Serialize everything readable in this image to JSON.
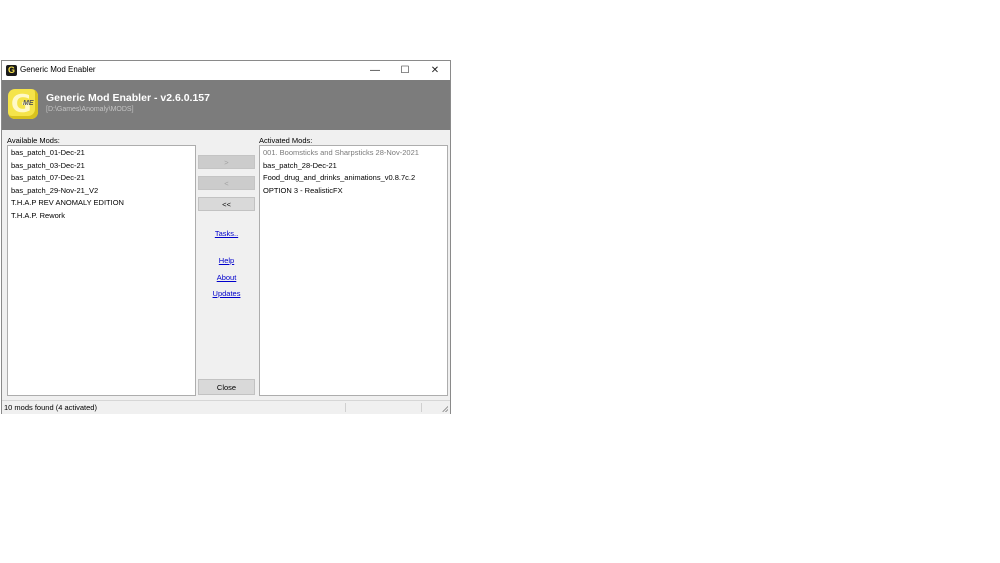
{
  "window": {
    "title": "Generic Mod Enabler",
    "controls": {
      "minimize": "—",
      "maximize": "☐",
      "close": "✕"
    }
  },
  "banner": {
    "title": "Generic Mod Enabler - v2.6.0.157",
    "path": "[D:\\Games\\Anomaly\\MODS]",
    "logo_letter": "G",
    "logo_badge": "ME",
    "background": "#7c7c7c",
    "logo_color": "#f5e44a"
  },
  "available": {
    "label": "Available Mods:",
    "items": [
      "bas_patch_01-Dec-21",
      "bas_patch_03-Dec-21",
      "bas_patch_07-Dec-21",
      "bas_patch_29-Nov-21_V2",
      "T.H.A.P REV ANOMALY EDITION",
      "T.H.A.P. Rework"
    ]
  },
  "activated": {
    "label": "Activated Mods:",
    "items": [
      {
        "text": "001. Boomsticks and Sharpsticks 28-Nov-2021",
        "disabled": true
      },
      {
        "text": "bas_patch_28-Dec-21",
        "disabled": false
      },
      {
        "text": "Food_drug_and_drinks_animations_v0.8.7c.2",
        "disabled": false
      },
      {
        "text": "OPTION 3 - RealisticFX",
        "disabled": false
      }
    ]
  },
  "buttons": {
    "activate": ">",
    "deactivate": "<",
    "deactivate_all": "<<",
    "close": "Close"
  },
  "links": {
    "tasks": "Tasks..",
    "help": "Help",
    "about": "About",
    "updates": "Updates"
  },
  "status": {
    "text": "10 mods found (4 activated)"
  },
  "colors": {
    "link": "#0000cc",
    "disabled_text": "#7a7a7a"
  }
}
